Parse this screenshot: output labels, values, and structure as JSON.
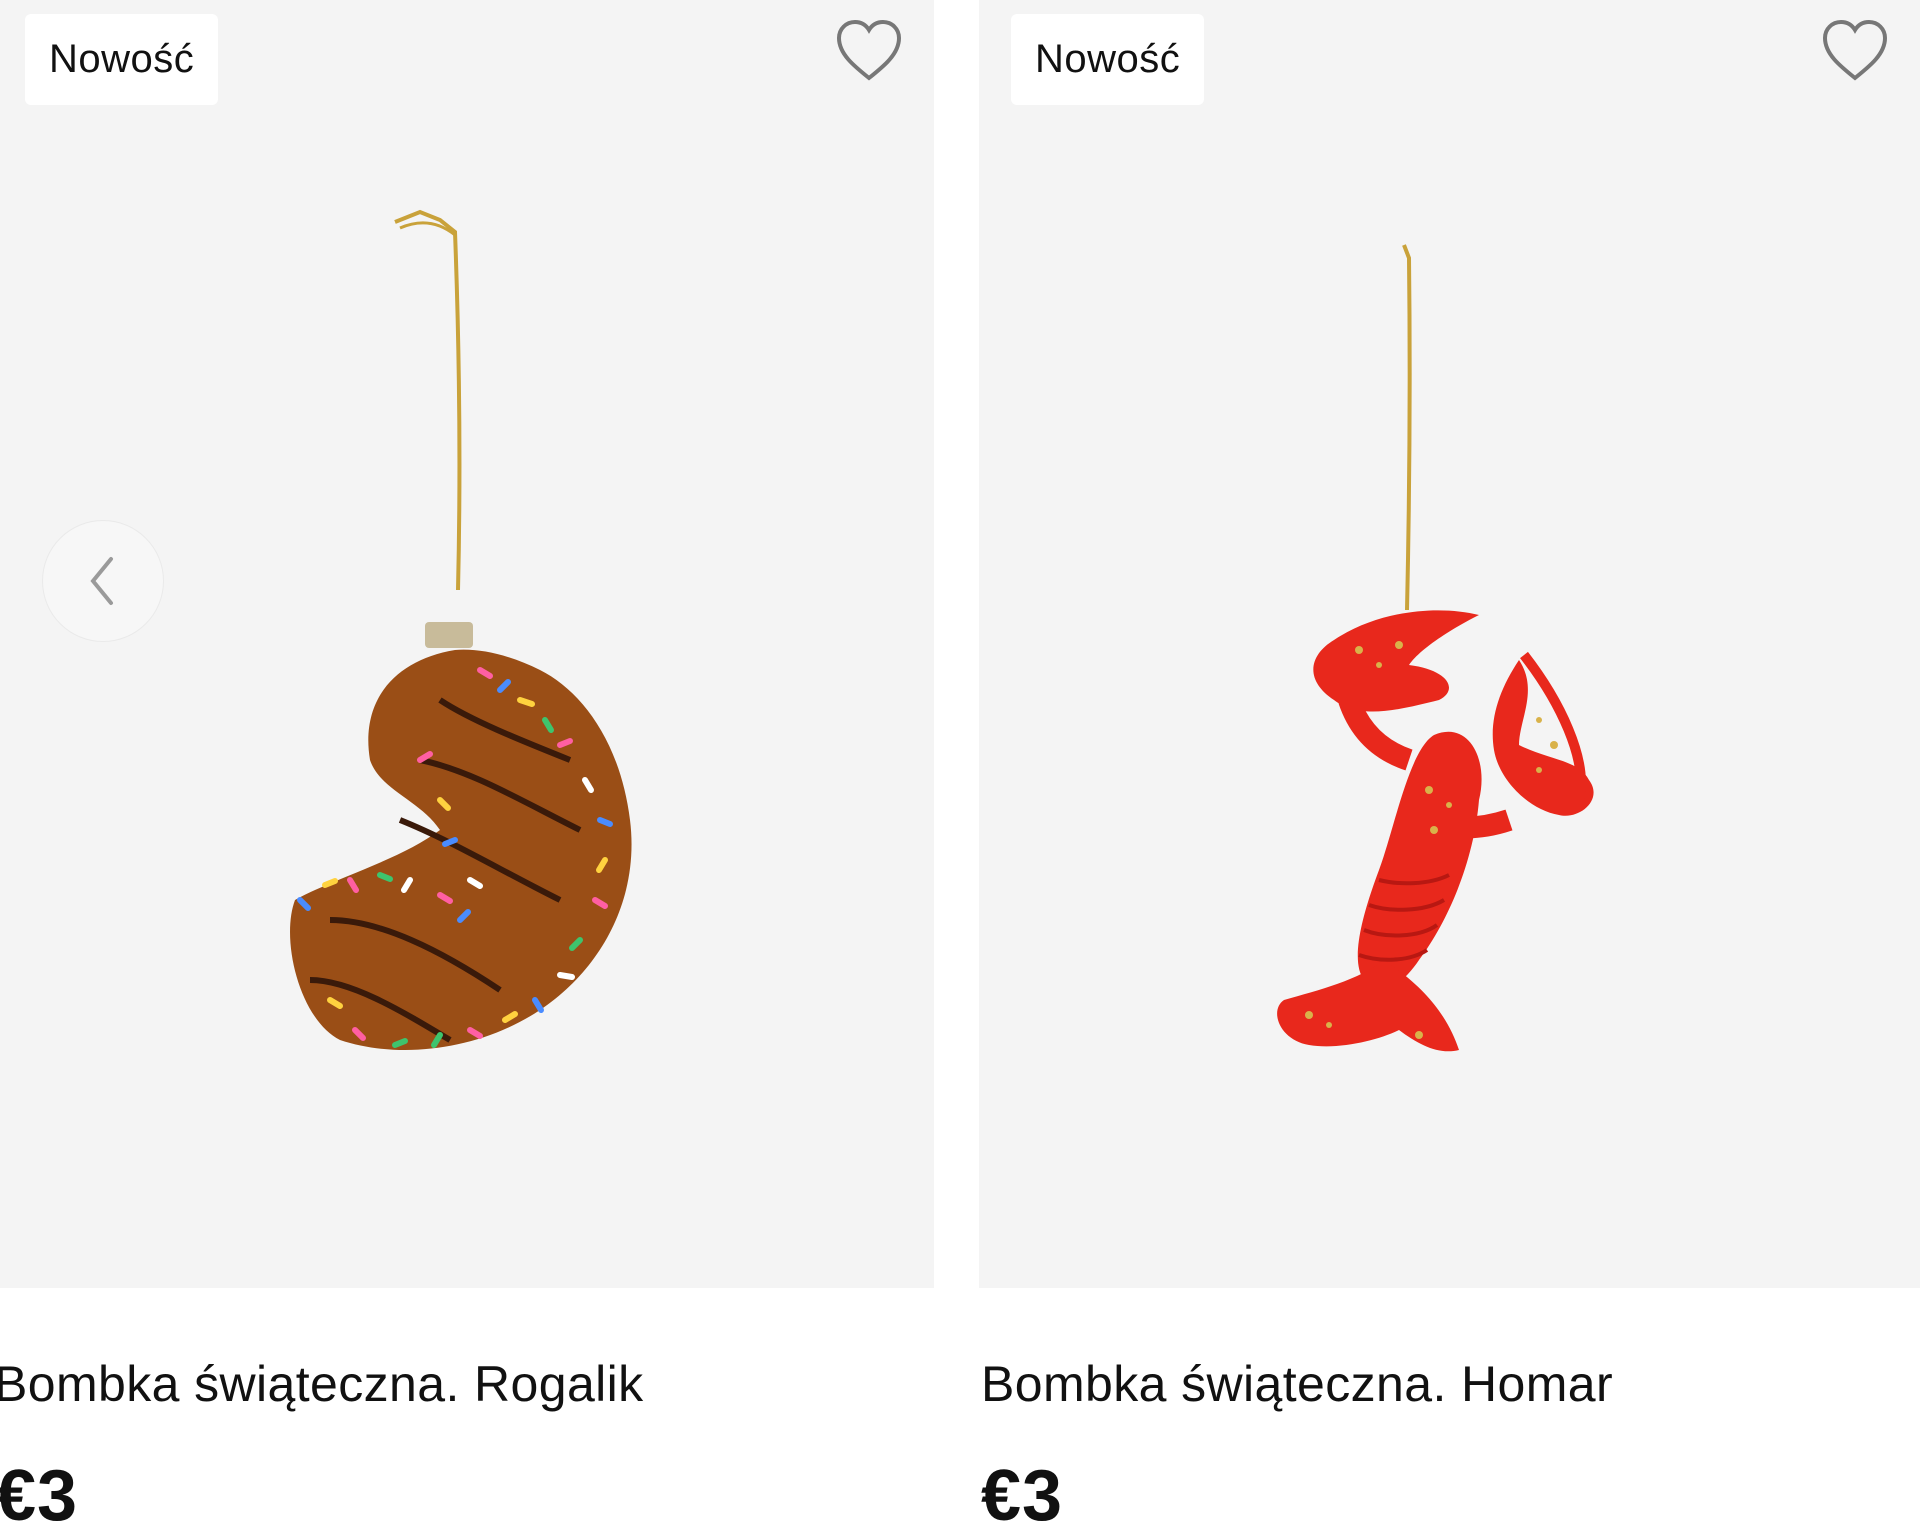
{
  "products": [
    {
      "badge": "Nowość",
      "title": "Bombka świąteczna. Rogalik",
      "price": "€3",
      "wishlist_icon": "heart-outline-icon",
      "image": "croissant-ornament",
      "colors": {
        "body": "#9a4e16",
        "glaze": "#3a1a0a"
      }
    },
    {
      "badge": "Nowość",
      "title": "Bombka świąteczna. Homar",
      "price": "€3",
      "wishlist_icon": "heart-outline-icon",
      "image": "lobster-ornament",
      "colors": {
        "body": "#e8281c",
        "glitter": "#d9b24a"
      }
    }
  ],
  "carousel": {
    "prev_icon": "chevron-left-icon"
  },
  "colors": {
    "image_bg": "#f4f4f4",
    "badge_bg": "#ffffff",
    "text": "#111111"
  }
}
